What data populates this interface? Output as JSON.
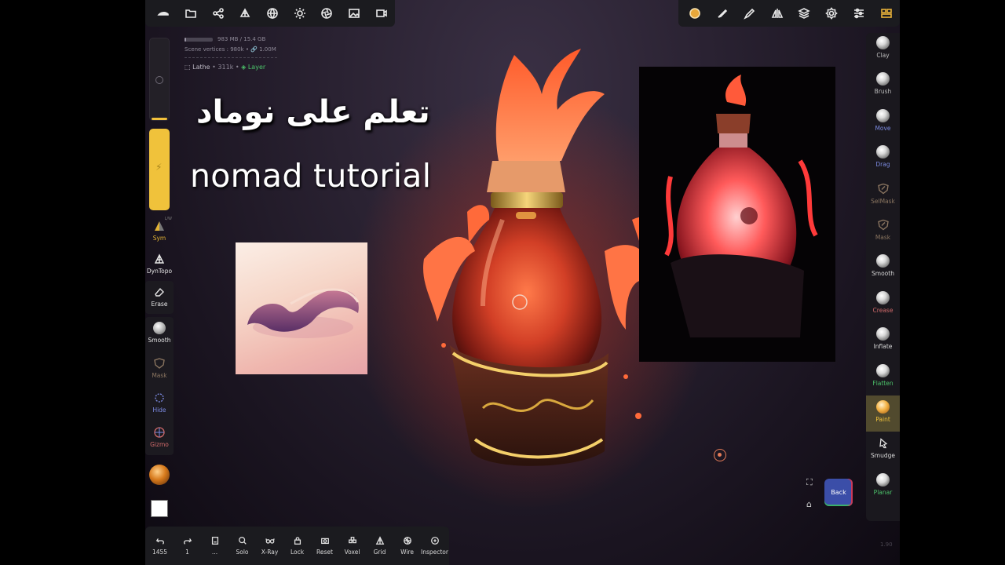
{
  "colors": {
    "accent_yellow": "#f0c23b",
    "layer_green": "#4cc36a",
    "panel_bg": "#1b1b1f",
    "back_blue": "#3b4ea8",
    "pivot_orange": "#e57c58"
  },
  "top_toolbar_left": [
    {
      "name": "nomad-logo-icon"
    },
    {
      "name": "folder-icon"
    },
    {
      "name": "share-nodes-icon"
    },
    {
      "name": "mesh-icon"
    },
    {
      "name": "globe-icon"
    },
    {
      "name": "sun-icon"
    },
    {
      "name": "camera-aperture-icon"
    },
    {
      "name": "image-icon"
    },
    {
      "name": "video-icon"
    }
  ],
  "top_toolbar_right": [
    {
      "name": "material-ball-icon"
    },
    {
      "name": "paint-brush-icon"
    },
    {
      "name": "pen-icon"
    },
    {
      "name": "symmetry-icon"
    },
    {
      "name": "layers-icon"
    },
    {
      "name": "settings-icon"
    },
    {
      "name": "sliders-icon"
    },
    {
      "name": "tools-grid-icon"
    }
  ],
  "stats": {
    "memory": "983 MB / 15.4 GB",
    "memory_fraction": 0.064,
    "scene_vertices": "Scene vertices : 980k • 🔗 1.00M",
    "object_name": "Lathe",
    "object_vertices": "• 311k •",
    "layer_label": "Layer"
  },
  "left_panel": {
    "sym_badge": "L/W",
    "sym_label": "Sym",
    "dyntopo_label": "DynTopo",
    "erase_label": "Erase",
    "smooth_label": "Smooth",
    "mask_label": "Mask",
    "hide_label": "Hide",
    "gizmo_label": "Gizmo"
  },
  "right_panel": [
    {
      "label": "Clay",
      "color": "#bdbdbd",
      "icon": "sphere"
    },
    {
      "label": "Brush",
      "color": "#bdbdbd",
      "icon": "sphere"
    },
    {
      "label": "Move",
      "color": "#7b8ae0",
      "icon": "sphere"
    },
    {
      "label": "Drag",
      "color": "#7b8ae0",
      "icon": "sphere"
    },
    {
      "label": "SelMask",
      "color": "#8a7560",
      "icon": "shield"
    },
    {
      "label": "Mask",
      "color": "#8a7560",
      "icon": "shield"
    },
    {
      "label": "Smooth",
      "color": "#d8d8d8",
      "icon": "sphere"
    },
    {
      "label": "Crease",
      "color": "#d06a6a",
      "icon": "sphere"
    },
    {
      "label": "Inflate",
      "color": "#d8d8d8",
      "icon": "sphere"
    },
    {
      "label": "Flatten",
      "color": "#4cc36a",
      "icon": "half"
    },
    {
      "label": "Paint",
      "color": "#f0c23b",
      "icon": "orange",
      "active": true
    },
    {
      "label": "Smudge",
      "color": "#d8d8d8",
      "icon": "smudge"
    },
    {
      "label": "Planar",
      "color": "#4cc36a",
      "icon": "half"
    }
  ],
  "bottom_toolbar": [
    {
      "label": "1455",
      "icon": "undo-icon"
    },
    {
      "label": "1",
      "icon": "redo-icon"
    },
    {
      "label": "...",
      "icon": "history-icon"
    },
    {
      "label": "Solo",
      "icon": "search-icon"
    },
    {
      "label": "X-Ray",
      "icon": "glasses-icon"
    },
    {
      "label": "Lock",
      "icon": "lock-icon"
    },
    {
      "label": "Reset",
      "icon": "camera-reset-icon"
    },
    {
      "label": "Voxel",
      "icon": "voxel-icon"
    },
    {
      "label": "Grid",
      "icon": "grid-icon"
    },
    {
      "label": "Wire",
      "icon": "wire-icon"
    },
    {
      "label": "Inspector",
      "icon": "inspector-icon"
    }
  ],
  "overlay": {
    "title_arabic": "تعلم على نوماد",
    "title_english": "nomad tutorial"
  },
  "back_label": "Back",
  "version": "1.90"
}
